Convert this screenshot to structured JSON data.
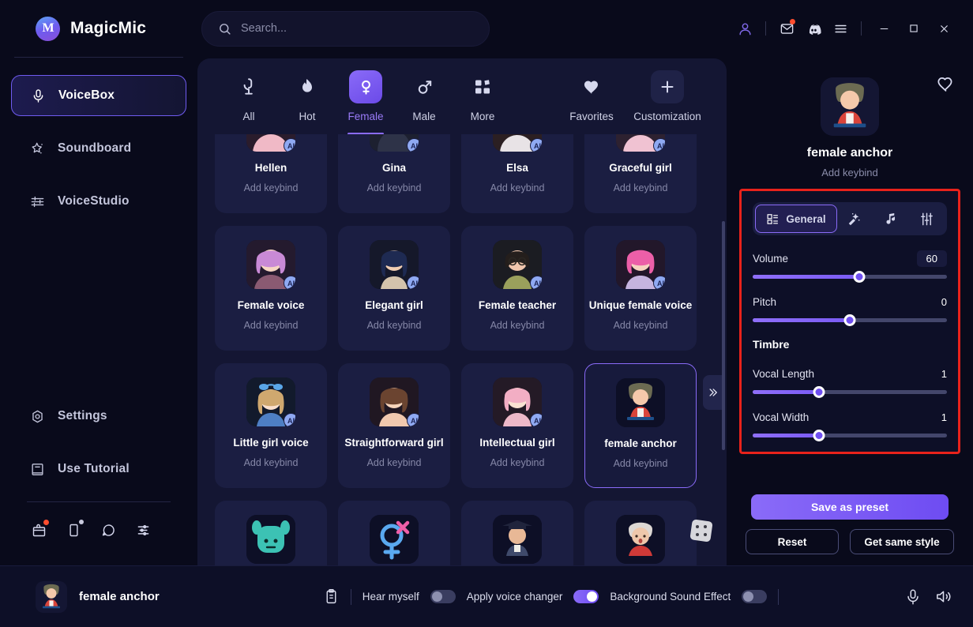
{
  "app": {
    "name": "MagicMic",
    "logo_icon": "magicmic-logo"
  },
  "search": {
    "placeholder": "Search...",
    "value": "",
    "icon": "search-icon"
  },
  "titlebar": {
    "icons": [
      "account-icon",
      "mail-icon",
      "discord-icon",
      "menu-icon"
    ],
    "window": [
      "minimize-icon",
      "maximize-icon",
      "close-icon"
    ]
  },
  "sidebar": {
    "items": [
      {
        "label": "VoiceBox",
        "icon": "microphone-icon",
        "active": true
      },
      {
        "label": "Soundboard",
        "icon": "sparkle-star-icon",
        "active": false
      },
      {
        "label": "VoiceStudio",
        "icon": "sliders-icon",
        "active": false
      }
    ],
    "bottom_items": [
      {
        "label": "Settings",
        "icon": "gear-icon"
      },
      {
        "label": "Use Tutorial",
        "icon": "book-icon"
      }
    ],
    "mini_icons": [
      "gift-icon",
      "mobile-icon",
      "chat-icon",
      "share-icon"
    ]
  },
  "categories": [
    {
      "label": "All",
      "icon": "microphone-outline-icon",
      "selected": false
    },
    {
      "label": "Hot",
      "icon": "flame-icon",
      "selected": false
    },
    {
      "label": "Female",
      "icon": "female-symbol-icon",
      "selected": true
    },
    {
      "label": "Male",
      "icon": "male-symbol-icon",
      "selected": false
    },
    {
      "label": "More",
      "icon": "grid-squares-icon",
      "selected": false
    }
  ],
  "categories_right": [
    {
      "label": "Favorites",
      "icon": "heart-icon"
    },
    {
      "label": "Customization",
      "icon": "plus-icon"
    }
  ],
  "voice_grid": {
    "keybind_label": "Add keybind",
    "ai_badge": "AI",
    "cards": [
      {
        "name": "Hellen",
        "avatar": "woman-blonde",
        "ai": true,
        "selected": false,
        "partial": true
      },
      {
        "name": "Gina",
        "avatar": "woman-dark-hood",
        "ai": true,
        "selected": false,
        "partial": true
      },
      {
        "name": "Elsa",
        "avatar": "woman-redhead",
        "ai": true,
        "selected": false,
        "partial": true
      },
      {
        "name": "Graceful girl",
        "avatar": "woman-pink-hair",
        "ai": true,
        "selected": false,
        "partial": true
      },
      {
        "name": "Female voice",
        "avatar": "woman-purple-hair",
        "ai": true,
        "selected": false,
        "partial": false
      },
      {
        "name": "Elegant girl",
        "avatar": "woman-blue-hair",
        "ai": true,
        "selected": false,
        "partial": false
      },
      {
        "name": "Female teacher",
        "avatar": "woman-glasses",
        "ai": true,
        "selected": false,
        "partial": false
      },
      {
        "name": "Unique female voice",
        "avatar": "woman-rose-hair",
        "ai": true,
        "selected": false,
        "partial": false
      },
      {
        "name": "Little girl voice",
        "avatar": "girl-blue-bow",
        "ai": true,
        "selected": false,
        "partial": false
      },
      {
        "name": "Straightforward girl",
        "avatar": "woman-brunette",
        "ai": true,
        "selected": false,
        "partial": false
      },
      {
        "name": "Intellectual girl",
        "avatar": "woman-pastel-pink",
        "ai": true,
        "selected": false,
        "partial": false
      },
      {
        "name": "female anchor",
        "avatar": "news-anchor",
        "ai": false,
        "selected": true,
        "partial": false
      }
    ],
    "partial_row": [
      {
        "avatar": "teal-monster"
      },
      {
        "avatar": "gender-symbols"
      },
      {
        "avatar": "graduate"
      },
      {
        "avatar": "grandma"
      }
    ],
    "expander_icon": "chevron-double-right-icon",
    "random_icon": "dice-icon"
  },
  "right_panel": {
    "favorite_icon": "heart-outline-icon",
    "avatar": "news-anchor",
    "name": "female anchor",
    "keybind": "Add keybind",
    "tabs": [
      {
        "label": "General",
        "icon": "grid-list-icon",
        "active": true
      },
      {
        "label": "",
        "icon": "magic-wand-icon",
        "active": false
      },
      {
        "label": "",
        "icon": "music-note-icon",
        "active": false
      },
      {
        "label": "",
        "icon": "equalizer-icon",
        "active": false
      }
    ],
    "sliders": [
      {
        "label": "Volume",
        "value": "60",
        "percent": 55,
        "boxed": true
      },
      {
        "label": "Pitch",
        "value": "0",
        "percent": 50,
        "boxed": false
      }
    ],
    "timbre_title": "Timbre",
    "timbre_sliders": [
      {
        "label": "Vocal Length",
        "value": "1",
        "percent": 34
      },
      {
        "label": "Vocal Width",
        "value": "1",
        "percent": 34
      }
    ],
    "actions": {
      "save": "Save as preset",
      "reset": "Reset",
      "get_same_style": "Get same style"
    },
    "highlight_color": "#e8221b"
  },
  "bottom_bar": {
    "current_voice": "female anchor",
    "avatar": "news-anchor",
    "clipboard_icon": "clipboard-icon",
    "toggles": [
      {
        "label": "Hear myself",
        "on": false
      },
      {
        "label": "Apply voice changer",
        "on": true
      },
      {
        "label": "Background Sound Effect",
        "on": false
      }
    ],
    "right_icons": [
      "microphone-icon",
      "speaker-icon"
    ]
  },
  "colors": {
    "accent": "#8a6bf8",
    "bg": "#090a1b",
    "panel": "#141633",
    "card": "#1b1e42",
    "highlight": "#e8221b"
  }
}
